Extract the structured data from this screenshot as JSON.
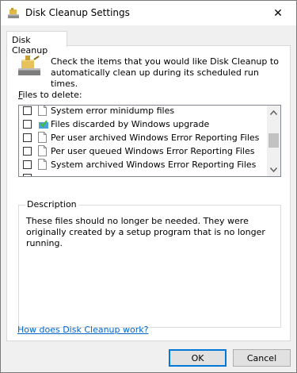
{
  "window": {
    "title": "Disk Cleanup Settings",
    "close_glyph": "✕"
  },
  "tabs": [
    {
      "label": "Disk Cleanup"
    }
  ],
  "intro": {
    "text": "Check the items that you would like Disk Cleanup to automatically clean up during its scheduled run times."
  },
  "files": {
    "label_prefix": "F",
    "label_rest": "iles to delete:",
    "items": [
      {
        "label": "System error minidump files",
        "checked": false,
        "icon": "document-icon"
      },
      {
        "label": "Files discarded by Windows upgrade",
        "checked": false,
        "icon": "recycle-icon"
      },
      {
        "label": "Per user archived Windows Error Reporting Files",
        "checked": false,
        "icon": "document-icon"
      },
      {
        "label": "Per user queued Windows Error Reporting Files",
        "checked": false,
        "icon": "document-icon"
      },
      {
        "label": "System archived Windows Error Reporting Files",
        "checked": false,
        "icon": "document-icon"
      }
    ]
  },
  "description": {
    "legend": "Description",
    "text": "These files should no longer be needed. They were originally created by a setup program that is no longer running."
  },
  "help_link": "How does Disk Cleanup work?",
  "buttons": {
    "ok": "OK",
    "cancel": "Cancel"
  },
  "colors": {
    "link": "#0066cc",
    "accent": "#0078d7"
  }
}
